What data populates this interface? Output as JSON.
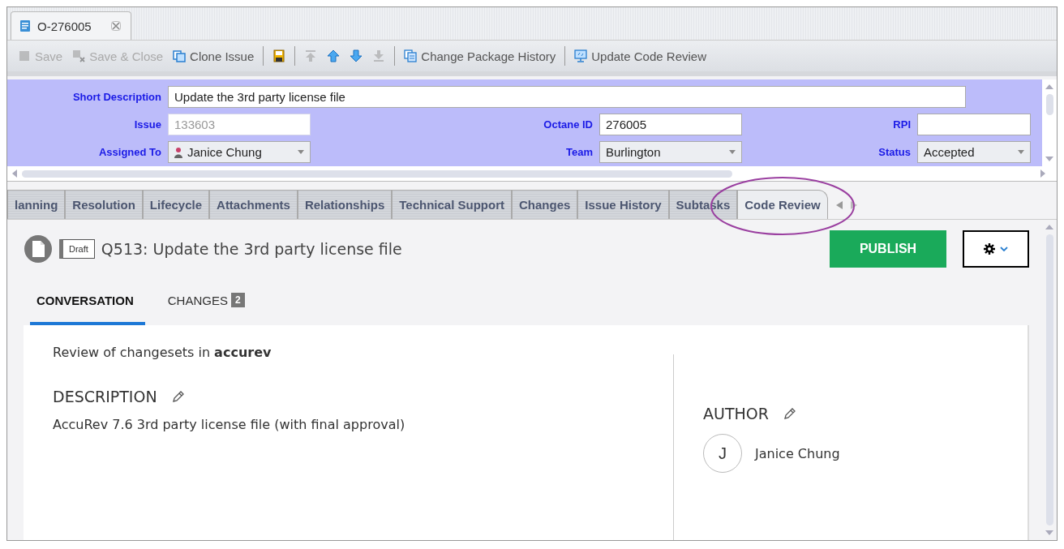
{
  "editor_tab": {
    "title": "O-276005"
  },
  "toolbar": [
    [
      {
        "label": "Save",
        "disabled": true
      },
      {
        "label": "Save & Close",
        "disabled": true
      },
      {
        "label": "Clone Issue",
        "disabled": false
      }
    ],
    [
      {
        "disabled": false
      }
    ],
    [
      {
        "disabled": true
      },
      {
        "disabled": false
      },
      {
        "disabled": false
      },
      {
        "disabled": true
      }
    ],
    [
      {
        "label": "Change Package History",
        "disabled": false
      }
    ],
    [
      {
        "label": "Update Code Review",
        "disabled": false
      }
    ]
  ],
  "form": {
    "rows": [
      [
        {
          "label": "Short Description",
          "value": "Update the 3rd party license file",
          "kind": "wide",
          "disabled": false
        }
      ],
      [
        {
          "label": "Issue",
          "value": "133603",
          "kind": "text",
          "disabled": true
        },
        {
          "label": "Octane ID",
          "value": "276005",
          "kind": "text",
          "disabled": false
        },
        {
          "label": "RPI",
          "kind": "text",
          "disabled": false
        }
      ],
      [
        {
          "label": "Assigned To",
          "value": "Janice Chung",
          "kind": "person",
          "disabled": false
        },
        {
          "label": "Team",
          "value": "Burlington",
          "kind": "select",
          "disabled": false
        },
        {
          "label": "Status",
          "value": "Accepted",
          "kind": "select",
          "disabled": false
        }
      ]
    ]
  },
  "tabs": [
    {
      "label": "lanning",
      "selected": false
    },
    {
      "label": "Resolution",
      "selected": false
    },
    {
      "label": "Lifecycle",
      "selected": false
    },
    {
      "label": "Attachments",
      "selected": false
    },
    {
      "label": "Relationships",
      "selected": false
    },
    {
      "label": "Technical Support",
      "selected": false
    },
    {
      "label": "Changes",
      "selected": false
    },
    {
      "label": "Issue History",
      "selected": false
    },
    {
      "label": "Subtasks",
      "selected": false
    },
    {
      "label": "Code Review",
      "selected": true
    }
  ],
  "review": {
    "status": "Draft",
    "title": "Q513: Update the 3rd party license file",
    "publish": "PUBLISH",
    "subtabs": [
      {
        "label": "CONVERSATION",
        "selected": true
      },
      {
        "label": "CHANGES",
        "count": "2",
        "selected": false
      }
    ],
    "summary": "Review of changesets in **accurev**",
    "description": {
      "heading": "DESCRIPTION",
      "text": "AccuRev 7.6 3rd party license file (with final approval)"
    },
    "author": {
      "heading": "AUTHOR",
      "initial": "J",
      "name": "Janice Chung"
    }
  }
}
